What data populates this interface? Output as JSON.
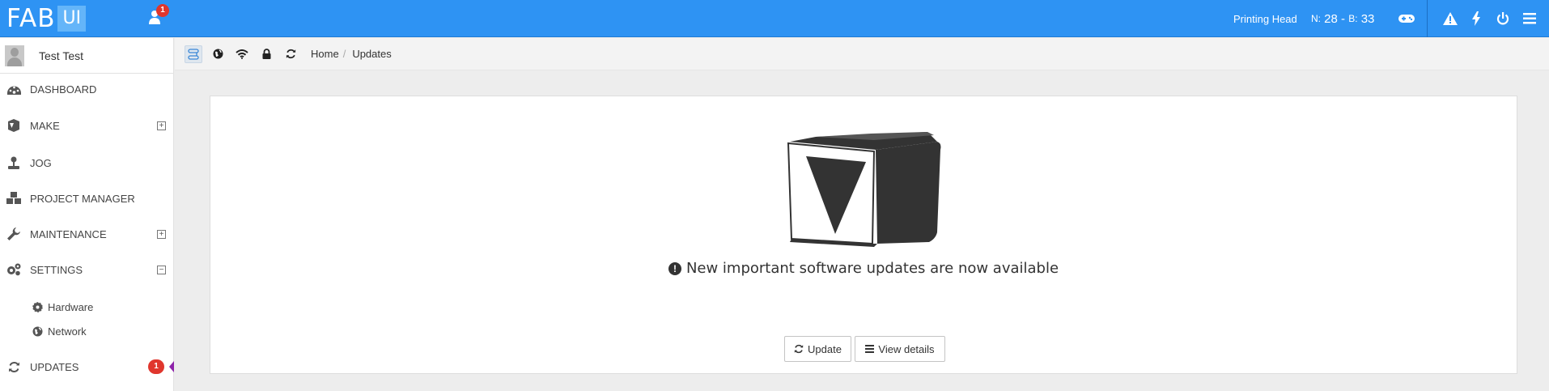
{
  "header": {
    "logo_main": "FAB",
    "logo_sub": "UI",
    "notification_count": "1",
    "printing_head": "Printing Head",
    "nozzle_label": "N:",
    "nozzle_value": "28",
    "bed_label": "B:",
    "bed_value": "33",
    "separator": "-",
    "colors": {
      "bar": "#2e93f3",
      "badge": "#e0362d"
    }
  },
  "sidebar": {
    "user_name": "Test Test",
    "items": [
      {
        "label": "DASHBOARD",
        "icon": "dashboard-icon"
      },
      {
        "label": "MAKE",
        "icon": "cube-icon",
        "toggle": "+"
      },
      {
        "label": "JOG",
        "icon": "joystick-icon"
      },
      {
        "label": "PROJECT MANAGER",
        "icon": "cubes-icon"
      },
      {
        "label": "MAINTENANCE",
        "icon": "wrench-icon",
        "toggle": "+"
      },
      {
        "label": "SETTINGS",
        "icon": "gears-icon",
        "toggle": "−"
      },
      {
        "label": "UPDATES",
        "icon": "refresh-icon",
        "badge": "1"
      }
    ],
    "sub_items": [
      {
        "label": "Hardware",
        "icon": "gear-icon"
      },
      {
        "label": "Network",
        "icon": "globe-icon"
      }
    ]
  },
  "breadcrumb": {
    "home": "Home",
    "current": "Updates"
  },
  "main": {
    "message": "New important software updates are now available",
    "update_button": "Update",
    "details_button": "View details"
  }
}
